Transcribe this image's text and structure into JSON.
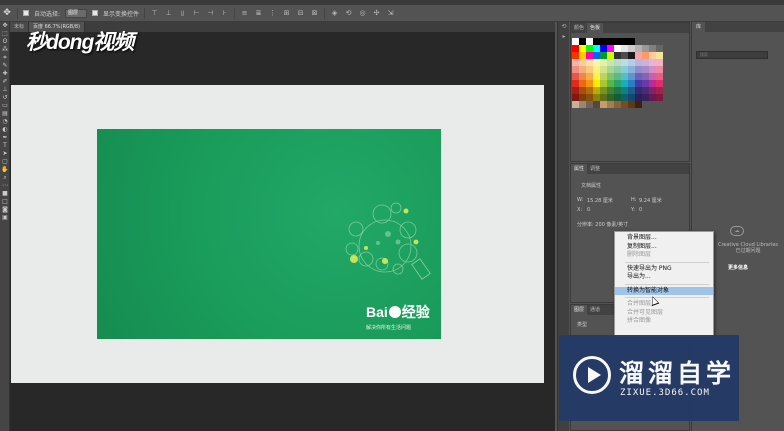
{
  "options_bar": {
    "auto_select_label": "自动选择:",
    "auto_select_value": "图层",
    "transform_controls_label": "显示变换控件"
  },
  "document_tab": {
    "title_partial": "未标",
    "title_partial_2": "百度",
    "zoom_info": "66.7%(RGB/8)"
  },
  "watermark": {
    "text": "秒dong视频"
  },
  "canvas_content": {
    "brand_name_prefix": "Bai",
    "brand_name_suffix": "经验",
    "slogan": "解决你所有生活问题"
  },
  "swatches_panel": {
    "tab_color": "颜色",
    "tab_swatches": "色板",
    "colors": [
      [
        "#ffffff",
        "#000000",
        "#ffffff",
        "#000000",
        "#000000",
        "#000000",
        "#000000",
        "#000000",
        "#000000"
      ],
      [
        "#ff0000",
        "#ffff00",
        "#00ff00",
        "#00ffff",
        "#0000ff",
        "#ff00ff",
        "#ffffff",
        "#e6e6e6",
        "#cccccc",
        "#b3b3b3",
        "#999999",
        "#808080",
        "#666666"
      ],
      [
        "#ff3300",
        "#ffcc00",
        "#ff00aa",
        "#0066ff",
        "#009933",
        "#ccff00",
        "#333333",
        "#4d4d4d",
        "#1a1a1a",
        "#f2a6a6",
        "#ff9966",
        "#ffcc99",
        "#f6e49a"
      ],
      [
        "#f7b2a5",
        "#f8c9a4",
        "#fbe0a6",
        "#fff4ad",
        "#e3efb0",
        "#c9e5b3",
        "#b7dbc3",
        "#b5dfe4",
        "#b6cbe8",
        "#b9b5dd",
        "#c7b3da",
        "#e6b4d5",
        "#f2b2c4"
      ],
      [
        "#ef8d80",
        "#f3ad7f",
        "#f8c97f",
        "#fff07d",
        "#d1e48a",
        "#a8d590",
        "#8ccaa3",
        "#87cdd6",
        "#8ab1dc",
        "#938bcb",
        "#a78ac7",
        "#d78bc0",
        "#eb8aa7"
      ],
      [
        "#e8584a",
        "#ee8747",
        "#f6ad43",
        "#fff04a",
        "#bbd65a",
        "#80c468",
        "#5eb786",
        "#54bdc7",
        "#5b96cf",
        "#6a61b9",
        "#8563b5",
        "#c860ab",
        "#e35f8a"
      ],
      [
        "#e2291d",
        "#ea6914",
        "#f29512",
        "#ffeb00",
        "#a6c832",
        "#5bb443",
        "#2aa466",
        "#16aeb8",
        "#2a7ec1",
        "#4638a5",
        "#673ba3",
        "#ba2b95",
        "#dd2e6d"
      ],
      [
        "#a51f15",
        "#ab4d0e",
        "#b16c0d",
        "#b9ab00",
        "#799224",
        "#428331",
        "#1f784a",
        "#107f86",
        "#1e5c8d",
        "#332979",
        "#4b2b77",
        "#881f6d",
        "#a2214f"
      ],
      [
        "#7f1810",
        "#833b0a",
        "#87530a",
        "#8e8300",
        "#5d701c",
        "#336525",
        "#175c39",
        "#0c6267",
        "#17476c",
        "#27205d",
        "#3a215c",
        "#691854",
        "#7c193d"
      ],
      [
        "#c7b299",
        "#998675",
        "#736357",
        "#534741",
        "#c69c6d",
        "#a67c52",
        "#8c6239",
        "#754c24",
        "#603913",
        "#42210b"
      ]
    ]
  },
  "properties_panel": {
    "tab_properties": "属性",
    "tab_adjust": "调整",
    "doc_properties": "文档属性",
    "w_label": "W:",
    "w_value": "15.28 厘米",
    "h_label": "H:",
    "h_value": "9.24 厘米",
    "x_label": "X:",
    "x_value": "0",
    "y_label": "Y:",
    "y_value": "0",
    "resolution": "分辨率: 200 像素/英寸"
  },
  "layers_panel": {
    "tab_layers": "图层",
    "tab_channels": "通道",
    "filter_label": "类型"
  },
  "libraries_panel": {
    "tab": "库",
    "search_placeholder": "搜索",
    "cc_message": "Creative Cloud Libraries 已过期问题",
    "more_info": "更多信息"
  },
  "context_menu": {
    "items": [
      {
        "label": "背景图层...",
        "disabled": false
      },
      {
        "label": "复制图层...",
        "disabled": false
      },
      {
        "label": "删除图层",
        "disabled": true
      },
      {
        "label": "快速导出为 PNG",
        "disabled": false,
        "separator_before": true
      },
      {
        "label": "导出为...",
        "disabled": false
      },
      {
        "label": "转换为智能对象",
        "disabled": false,
        "highlighted": true,
        "separator_before": true
      },
      {
        "label": "合并图层",
        "disabled": true,
        "separator_before": true
      },
      {
        "label": "合并可见图层",
        "disabled": true
      },
      {
        "label": "拼合图像",
        "disabled": true
      }
    ]
  },
  "overlay_logo": {
    "name_cn": "溜溜自学",
    "url": "ZIXUE.3D66.COM"
  }
}
